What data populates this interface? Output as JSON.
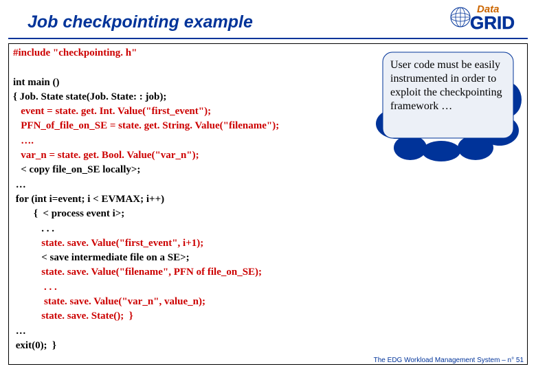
{
  "title": "Job checkpointing example",
  "logo": {
    "data_text": "Data",
    "grid_text": "GRID"
  },
  "code": {
    "l01": "#include \"checkpointing. h\"",
    "l02": "",
    "l03": "int main ()",
    "l04": "{ Job. State state(Job. State: : job);",
    "l05": "   event = state. get. Int. Value(\"first_event\");",
    "l06": "   PFN_of_file_on_SE = state. get. String. Value(\"filename\");",
    "l07": "   ….",
    "l08": "   var_n = state. get. Bool. Value(\"var_n\");",
    "l09": "   < copy file_on_SE locally>;",
    "l10": " …",
    "l11": " for (int i=event; i < EVMAX; i++)",
    "l12": "        {  < process event i>;",
    "l13": "           . . .",
    "l14": "           state. save. Value(\"first_event\", i+1);",
    "l15": "           < save intermediate file on a SE>;",
    "l16": "           state. save. Value(\"filename\", PFN of file_on_SE);",
    "l17": "            . . .",
    "l18": "            state. save. Value(\"var_n\", value_n);",
    "l19": "           state. save. State();  }",
    "l20": " …",
    "l21": " exit(0);  }"
  },
  "bubble": {
    "text": "User code must be easily instrumented in order to exploit the checkpointing framework …"
  },
  "footer": {
    "text": "The EDG Workload Management System –   n° 51"
  }
}
